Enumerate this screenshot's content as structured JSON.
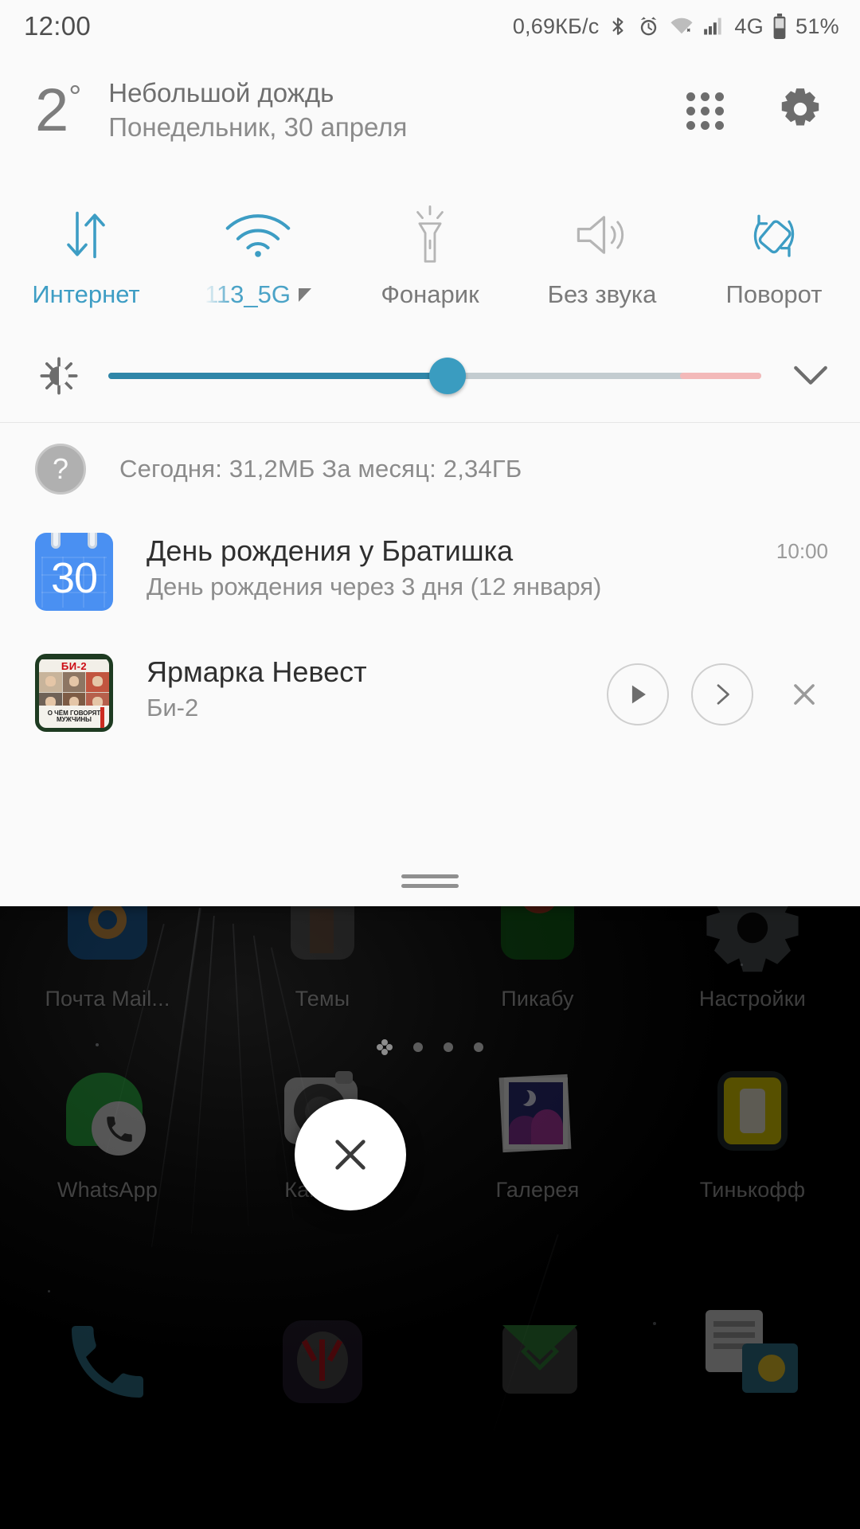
{
  "statusbar": {
    "clock": "12:00",
    "net_speed": "0,69КБ/с",
    "network_type": "4G",
    "battery": "51%",
    "icons": [
      "bluetooth-icon",
      "alarm-icon",
      "wifi-icon",
      "cell-signal-icon",
      "battery-icon"
    ]
  },
  "weather": {
    "temperature": "2",
    "degree": "°",
    "condition": "Небольшой дождь",
    "date": "Понедельник, 30 апреля",
    "grid_icon": "app-grid-icon",
    "settings_icon": "gear-icon"
  },
  "quick_settings": {
    "tiles": [
      {
        "label": "Интернет",
        "icon": "data-transfer-icon",
        "state": "on"
      },
      {
        "label": "113_5G",
        "icon": "wifi-icon",
        "state": "on"
      },
      {
        "label": "Фонарик",
        "icon": "flashlight-icon",
        "state": "off"
      },
      {
        "label": "Без звука",
        "icon": "volume-icon",
        "state": "off"
      },
      {
        "label": "Поворот",
        "icon": "rotation-icon",
        "state": "on"
      }
    ],
    "brightness": {
      "icon": "brightness-icon",
      "value_percent": 52,
      "expand_icon": "chevron-down-icon"
    },
    "colors": {
      "accent": "#3d9dc4",
      "slider_fill": "#2f86a8",
      "slider_track": "#c3ccd0",
      "slider_warn": "#f3b9b9",
      "inactive": "#9a9a9a"
    }
  },
  "data_usage": {
    "help_icon": "question-mark-icon",
    "text": "Сегодня: 31,2МБ   За месяц: 2,34ГБ"
  },
  "notifications": [
    {
      "icon": "calendar-icon",
      "icon_day": "30",
      "title": "День рождения у Братишка",
      "subtitle": "День рождения через 3 дня (12 января)",
      "time": "10:00"
    },
    {
      "icon": "album-art",
      "album_artist_badge": "БИ-2",
      "album_banner_line1": "О ЧЁМ ГОВОРЯТ",
      "album_banner_line2": "МУЖЧИНЫ",
      "title": "Ярмарка Невест",
      "subtitle": "Би-2",
      "actions": [
        "play-icon",
        "next-icon",
        "close-icon"
      ]
    }
  ],
  "shade": {
    "drag_handle": "drag-handle"
  },
  "homescreen": {
    "rows": [
      [
        {
          "label": "Почта Mail...",
          "icon": "mail-ru-icon"
        },
        {
          "label": "Темы",
          "icon": "themes-icon"
        },
        {
          "label": "Пикабу",
          "icon": "pikabu-icon"
        },
        {
          "label": "Настройки",
          "icon": "settings-icon"
        }
      ],
      [
        {
          "label": "WhatsApp",
          "icon": "whatsapp-icon"
        },
        {
          "label": "Камера",
          "icon": "camera-icon"
        },
        {
          "label": "Галерея",
          "icon": "gallery-icon"
        },
        {
          "label": "Тинькофф",
          "icon": "tinkoff-icon"
        }
      ]
    ],
    "page_dots": {
      "count": 4,
      "active_index": 0
    },
    "dock": [
      {
        "icon": "phone-icon"
      },
      {
        "icon": "yandex-icon"
      },
      {
        "icon": "mail-icon"
      },
      {
        "icon": "messages-icon"
      }
    ],
    "fab": {
      "icon": "close-icon"
    }
  }
}
